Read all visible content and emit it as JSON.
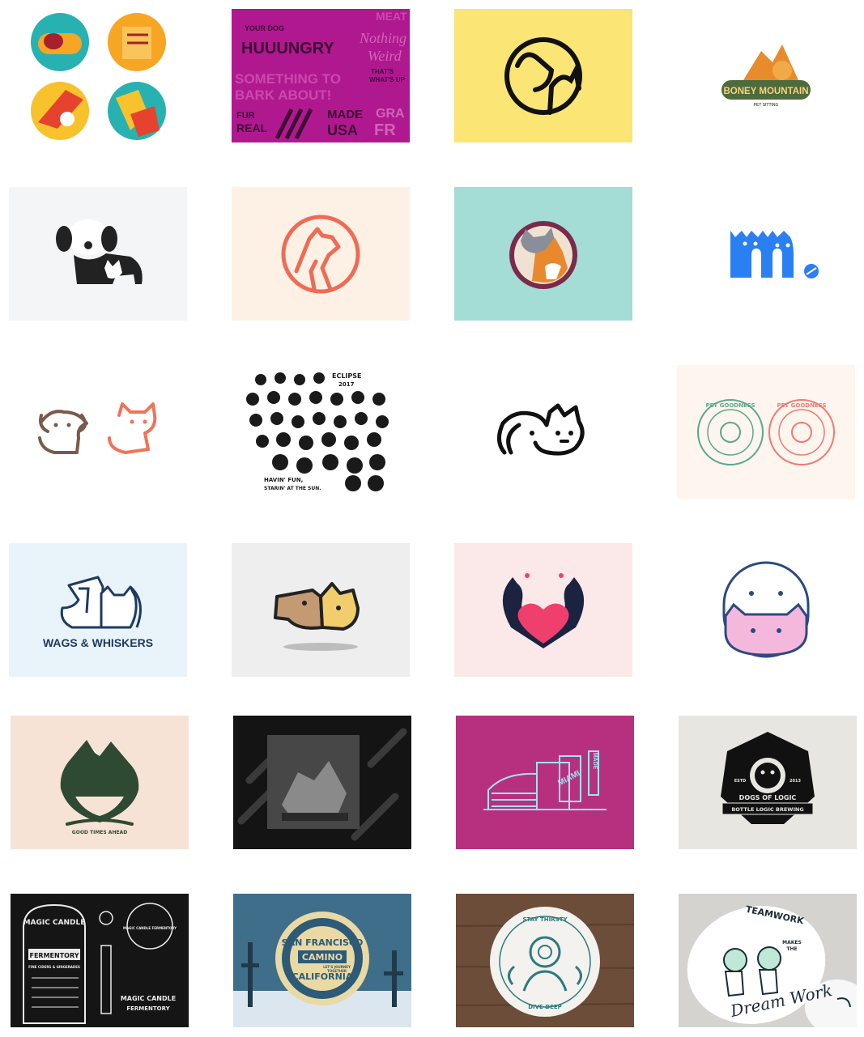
{
  "colors": {
    "page_bg": "#ffffff"
  },
  "gallery": [
    {
      "name": "pet-icon-set",
      "bg": "#ffffff",
      "texts": []
    },
    {
      "name": "hungry-dog-typography-pattern",
      "bg": "#b0188f",
      "texts": [
        "YOUR DOG",
        "HUUUNGRY",
        "Nothing",
        "Weird",
        "SOMETHING TO",
        "BARK ABOUT!",
        "MADE",
        "USA",
        "FUR",
        "REAL",
        "GRA",
        "FR",
        "MEAT",
        "THAT'S",
        "WHAT'S UP"
      ]
    },
    {
      "name": "circle-dog-cat-line-logo",
      "bg": "#fbe574",
      "texts": []
    },
    {
      "name": "boney-mountain-logo",
      "bg": "#ffffff",
      "texts": [
        "BONEY MOUNTAIN",
        "PET SITTING"
      ]
    },
    {
      "name": "dog-cat-silhouette-logo",
      "bg": "#f4f5f7",
      "texts": []
    },
    {
      "name": "orange-line-dog-cat-circle",
      "bg": "#fdf1e6",
      "texts": []
    },
    {
      "name": "cat-corgi-badge",
      "bg": "#a4dcd6",
      "texts": []
    },
    {
      "name": "m-cat-letter-logo",
      "bg": "#ffffff",
      "texts": []
    },
    {
      "name": "puppy-kitten-line-icons",
      "bg": "#ffffff",
      "texts": []
    },
    {
      "name": "eclipse-2017-faces-illustration",
      "bg": "#ffffff",
      "texts": [
        "ECLIPSE",
        "2017",
        "HAVIN' FUN,",
        "STARIN' AT THE SUN."
      ]
    },
    {
      "name": "dog-cat-outline-logo",
      "bg": "#ffffff",
      "texts": []
    },
    {
      "name": "pet-goodness-badges",
      "bg": "#fdf5ee",
      "texts": [
        "PET GOODNESS",
        "PET GOODNESS"
      ]
    },
    {
      "name": "wags-and-whiskers-logo",
      "bg": "#e9f4fa",
      "texts": [
        "WAGS & WHISKERS"
      ]
    },
    {
      "name": "dog-cat-face-split-logo",
      "bg": "#eeeeee",
      "texts": []
    },
    {
      "name": "cats-heart-logo",
      "bg": "#fbe8e8",
      "texts": []
    },
    {
      "name": "dog-cat-stacked-outline-logo",
      "bg": "#ffffff",
      "texts": []
    },
    {
      "name": "good-times-ahead-mountain-badge",
      "bg": "#f7e3d5",
      "texts": [
        "GOOD TIMES AHEAD"
      ]
    },
    {
      "name": "dark-poster-photo",
      "bg": "#141414",
      "texts": []
    },
    {
      "name": "miami-made-building-illustration",
      "bg": "#b7307f",
      "texts": [
        "MIAMI",
        "MADE"
      ]
    },
    {
      "name": "dogs-of-logic-badge",
      "bg": "#e8e6e1",
      "texts": [
        "DOGS OF LOGIC",
        "BOTTLE LOGIC BREWING",
        "ESTD",
        "2013"
      ]
    },
    {
      "name": "magic-candle-fermentory-labels",
      "bg": "#151515",
      "texts": [
        "MAGIC CANDLE",
        "FERMENTORY",
        "FINE CIDERS & GINGERADES",
        "MAGIC CANDLE FERMENTORY",
        "MAGIC CANDLE",
        "FERMENTORY"
      ]
    },
    {
      "name": "san-francisco-camino-california",
      "bg": "#3e6e8a",
      "texts": [
        "SAN FRANCISCO",
        "CAMINO",
        "CALIFORNIA",
        "LET'S JOURNEY",
        "TOGETHER"
      ]
    },
    {
      "name": "stay-thirsty-coaster",
      "bg": "#6b4d39",
      "texts": [
        "STAY THIRSTY",
        "DIVE DEEP"
      ]
    },
    {
      "name": "teamwork-dream-work-coaster",
      "bg": "#d5d3cf",
      "texts": [
        "TEAMWORK",
        "MAKES",
        "THE",
        "Dream Work"
      ]
    }
  ]
}
